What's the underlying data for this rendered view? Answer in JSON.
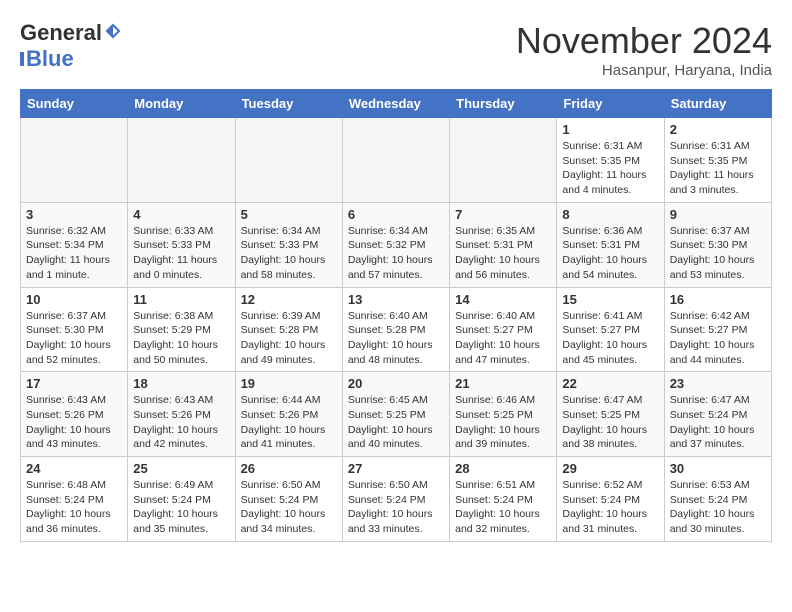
{
  "header": {
    "logo_general": "General",
    "logo_blue": "Blue",
    "month_title": "November 2024",
    "location": "Hasanpur, Haryana, India"
  },
  "weekdays": [
    "Sunday",
    "Monday",
    "Tuesday",
    "Wednesday",
    "Thursday",
    "Friday",
    "Saturday"
  ],
  "weeks": [
    [
      {
        "day": "",
        "info": ""
      },
      {
        "day": "",
        "info": ""
      },
      {
        "day": "",
        "info": ""
      },
      {
        "day": "",
        "info": ""
      },
      {
        "day": "",
        "info": ""
      },
      {
        "day": "1",
        "info": "Sunrise: 6:31 AM\nSunset: 5:35 PM\nDaylight: 11 hours\nand 4 minutes."
      },
      {
        "day": "2",
        "info": "Sunrise: 6:31 AM\nSunset: 5:35 PM\nDaylight: 11 hours\nand 3 minutes."
      }
    ],
    [
      {
        "day": "3",
        "info": "Sunrise: 6:32 AM\nSunset: 5:34 PM\nDaylight: 11 hours\nand 1 minute."
      },
      {
        "day": "4",
        "info": "Sunrise: 6:33 AM\nSunset: 5:33 PM\nDaylight: 11 hours\nand 0 minutes."
      },
      {
        "day": "5",
        "info": "Sunrise: 6:34 AM\nSunset: 5:33 PM\nDaylight: 10 hours\nand 58 minutes."
      },
      {
        "day": "6",
        "info": "Sunrise: 6:34 AM\nSunset: 5:32 PM\nDaylight: 10 hours\nand 57 minutes."
      },
      {
        "day": "7",
        "info": "Sunrise: 6:35 AM\nSunset: 5:31 PM\nDaylight: 10 hours\nand 56 minutes."
      },
      {
        "day": "8",
        "info": "Sunrise: 6:36 AM\nSunset: 5:31 PM\nDaylight: 10 hours\nand 54 minutes."
      },
      {
        "day": "9",
        "info": "Sunrise: 6:37 AM\nSunset: 5:30 PM\nDaylight: 10 hours\nand 53 minutes."
      }
    ],
    [
      {
        "day": "10",
        "info": "Sunrise: 6:37 AM\nSunset: 5:30 PM\nDaylight: 10 hours\nand 52 minutes."
      },
      {
        "day": "11",
        "info": "Sunrise: 6:38 AM\nSunset: 5:29 PM\nDaylight: 10 hours\nand 50 minutes."
      },
      {
        "day": "12",
        "info": "Sunrise: 6:39 AM\nSunset: 5:28 PM\nDaylight: 10 hours\nand 49 minutes."
      },
      {
        "day": "13",
        "info": "Sunrise: 6:40 AM\nSunset: 5:28 PM\nDaylight: 10 hours\nand 48 minutes."
      },
      {
        "day": "14",
        "info": "Sunrise: 6:40 AM\nSunset: 5:27 PM\nDaylight: 10 hours\nand 47 minutes."
      },
      {
        "day": "15",
        "info": "Sunrise: 6:41 AM\nSunset: 5:27 PM\nDaylight: 10 hours\nand 45 minutes."
      },
      {
        "day": "16",
        "info": "Sunrise: 6:42 AM\nSunset: 5:27 PM\nDaylight: 10 hours\nand 44 minutes."
      }
    ],
    [
      {
        "day": "17",
        "info": "Sunrise: 6:43 AM\nSunset: 5:26 PM\nDaylight: 10 hours\nand 43 minutes."
      },
      {
        "day": "18",
        "info": "Sunrise: 6:43 AM\nSunset: 5:26 PM\nDaylight: 10 hours\nand 42 minutes."
      },
      {
        "day": "19",
        "info": "Sunrise: 6:44 AM\nSunset: 5:26 PM\nDaylight: 10 hours\nand 41 minutes."
      },
      {
        "day": "20",
        "info": "Sunrise: 6:45 AM\nSunset: 5:25 PM\nDaylight: 10 hours\nand 40 minutes."
      },
      {
        "day": "21",
        "info": "Sunrise: 6:46 AM\nSunset: 5:25 PM\nDaylight: 10 hours\nand 39 minutes."
      },
      {
        "day": "22",
        "info": "Sunrise: 6:47 AM\nSunset: 5:25 PM\nDaylight: 10 hours\nand 38 minutes."
      },
      {
        "day": "23",
        "info": "Sunrise: 6:47 AM\nSunset: 5:24 PM\nDaylight: 10 hours\nand 37 minutes."
      }
    ],
    [
      {
        "day": "24",
        "info": "Sunrise: 6:48 AM\nSunset: 5:24 PM\nDaylight: 10 hours\nand 36 minutes."
      },
      {
        "day": "25",
        "info": "Sunrise: 6:49 AM\nSunset: 5:24 PM\nDaylight: 10 hours\nand 35 minutes."
      },
      {
        "day": "26",
        "info": "Sunrise: 6:50 AM\nSunset: 5:24 PM\nDaylight: 10 hours\nand 34 minutes."
      },
      {
        "day": "27",
        "info": "Sunrise: 6:50 AM\nSunset: 5:24 PM\nDaylight: 10 hours\nand 33 minutes."
      },
      {
        "day": "28",
        "info": "Sunrise: 6:51 AM\nSunset: 5:24 PM\nDaylight: 10 hours\nand 32 minutes."
      },
      {
        "day": "29",
        "info": "Sunrise: 6:52 AM\nSunset: 5:24 PM\nDaylight: 10 hours\nand 31 minutes."
      },
      {
        "day": "30",
        "info": "Sunrise: 6:53 AM\nSunset: 5:24 PM\nDaylight: 10 hours\nand 30 minutes."
      }
    ]
  ]
}
